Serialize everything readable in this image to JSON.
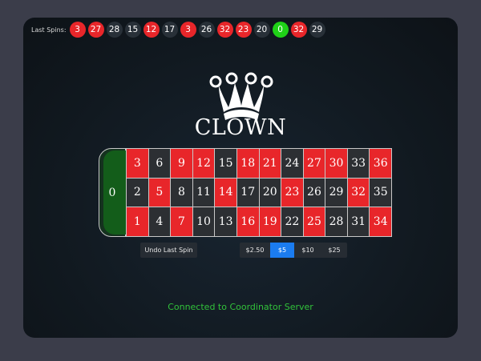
{
  "last_spins": {
    "label": "Last Spins:",
    "items": [
      {
        "value": "3",
        "color": "red"
      },
      {
        "value": "27",
        "color": "red"
      },
      {
        "value": "28",
        "color": "black"
      },
      {
        "value": "15",
        "color": "black"
      },
      {
        "value": "12",
        "color": "red"
      },
      {
        "value": "17",
        "color": "black"
      },
      {
        "value": "3",
        "color": "red"
      },
      {
        "value": "26",
        "color": "black"
      },
      {
        "value": "32",
        "color": "red"
      },
      {
        "value": "23",
        "color": "red"
      },
      {
        "value": "20",
        "color": "black"
      },
      {
        "value": "0",
        "color": "green"
      },
      {
        "value": "32",
        "color": "red"
      },
      {
        "value": "29",
        "color": "black"
      }
    ]
  },
  "brand": {
    "name": "CLOWN",
    "logo_icon": "jester-crown-icon"
  },
  "board": {
    "zero": "0",
    "rows": [
      [
        {
          "n": "3",
          "c": "red"
        },
        {
          "n": "6",
          "c": "black"
        },
        {
          "n": "9",
          "c": "red"
        },
        {
          "n": "12",
          "c": "red"
        },
        {
          "n": "15",
          "c": "black"
        },
        {
          "n": "18",
          "c": "red"
        },
        {
          "n": "21",
          "c": "red"
        },
        {
          "n": "24",
          "c": "black"
        },
        {
          "n": "27",
          "c": "red"
        },
        {
          "n": "30",
          "c": "red"
        },
        {
          "n": "33",
          "c": "black"
        },
        {
          "n": "36",
          "c": "red"
        }
      ],
      [
        {
          "n": "2",
          "c": "black"
        },
        {
          "n": "5",
          "c": "red"
        },
        {
          "n": "8",
          "c": "black"
        },
        {
          "n": "11",
          "c": "black"
        },
        {
          "n": "14",
          "c": "red"
        },
        {
          "n": "17",
          "c": "black"
        },
        {
          "n": "20",
          "c": "black"
        },
        {
          "n": "23",
          "c": "red"
        },
        {
          "n": "26",
          "c": "black"
        },
        {
          "n": "29",
          "c": "black"
        },
        {
          "n": "32",
          "c": "red"
        },
        {
          "n": "35",
          "c": "black"
        }
      ],
      [
        {
          "n": "1",
          "c": "red"
        },
        {
          "n": "4",
          "c": "black"
        },
        {
          "n": "7",
          "c": "red"
        },
        {
          "n": "10",
          "c": "black"
        },
        {
          "n": "13",
          "c": "black"
        },
        {
          "n": "16",
          "c": "red"
        },
        {
          "n": "19",
          "c": "red"
        },
        {
          "n": "22",
          "c": "black"
        },
        {
          "n": "25",
          "c": "red"
        },
        {
          "n": "28",
          "c": "black"
        },
        {
          "n": "31",
          "c": "black"
        },
        {
          "n": "34",
          "c": "red"
        }
      ]
    ]
  },
  "controls": {
    "undo_label": "Undo Last Spin",
    "chips": [
      {
        "label": "$2.50",
        "active": false
      },
      {
        "label": "$5",
        "active": true
      },
      {
        "label": "$10",
        "active": false
      },
      {
        "label": "$25",
        "active": false
      }
    ]
  },
  "status": "Connected to Coordinator Server",
  "colors": {
    "red": "#e8262a",
    "black": "#2c2f33",
    "green": "#1fd117",
    "accent": "#1b7cf0",
    "status": "#31c23a"
  }
}
